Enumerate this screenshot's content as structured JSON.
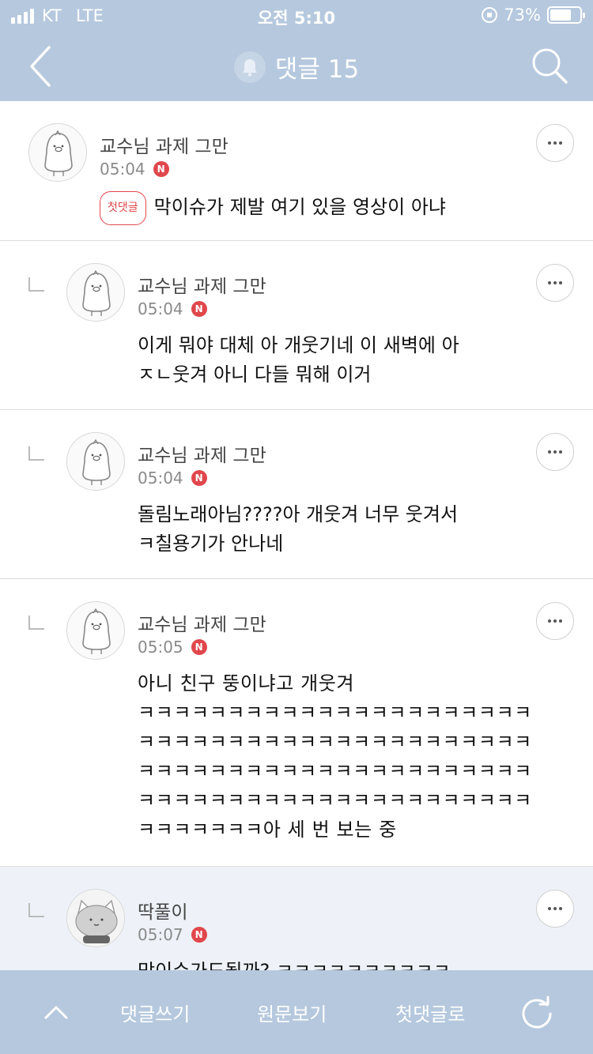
{
  "status_bar": {
    "carrier": "KT",
    "network": "LTE",
    "time": "오전 5:10",
    "battery_percent": "73%",
    "battery_level": 0.73
  },
  "header": {
    "title": "댓글 15",
    "back_icon": "chevron-left-icon",
    "bell_icon": "bell-icon",
    "search_icon": "search-icon"
  },
  "comments": [
    {
      "author": "교수님 과제 그만",
      "time": "05:04",
      "badge": "N",
      "first_comment_label": "첫댓글",
      "text": "막이슈가 제발 여기 있을 영상이 아냐"
    },
    {
      "author": "교수님 과제 그만",
      "time": "05:04",
      "badge": "N",
      "text": "이게 뭐야 대체 아 개웃기네 이 새벽에 아\nㅈㄴ웃겨 아니 다들 뭐해 이거"
    },
    {
      "author": "교수님 과제 그만",
      "time": "05:04",
      "badge": "N",
      "text": "돌림노래아님????아 개웃겨 너무 웃겨서\nㅋ칠용기가 안나네"
    },
    {
      "author": "교수님 과제 그만",
      "time": "05:05",
      "badge": "N",
      "text": "아니 친구 뚱이냐고 개웃겨\nㅋㅋㅋㅋㅋㅋㅋㅋㅋㅋㅋㅋㅋㅋㅋㅋㅋㅋㅋㅋㅋㅋ\nㅋㅋㅋㅋㅋㅋㅋㅋㅋㅋㅋㅋㅋㅋㅋㅋㅋㅋㅋㅋㅋㅋ\nㅋㅋㅋㅋㅋㅋㅋㅋㅋㅋㅋㅋㅋㅋㅋㅋㅋㅋㅋㅋㅋㅋ\nㅋㅋㅋㅋㅋㅋㅋㅋㅋㅋㅋㅋㅋㅋㅋㅋㅋㅋㅋㅋㅋㅋ\nㅋㅋㅋㅋㅋㅋㅋ아 세 번 보는 중"
    },
    {
      "author": "딱풀이",
      "time": "05:07",
      "badge": "N",
      "text": "막이슈가도될까? ㅋㅋㅋㅋㅋㅋㅋㅋㅋㅋ"
    }
  ],
  "more_icon": "more-dots-icon",
  "bottom_bar": {
    "up_icon": "chevron-up-icon",
    "write": "댓글쓰기",
    "view_original": "원문보기",
    "to_first": "첫댓글로",
    "refresh_icon": "refresh-icon"
  },
  "colors": {
    "header_bg": "#b5c8de",
    "badge_red": "#e0474c",
    "highlight_row": "#eef2f8"
  }
}
